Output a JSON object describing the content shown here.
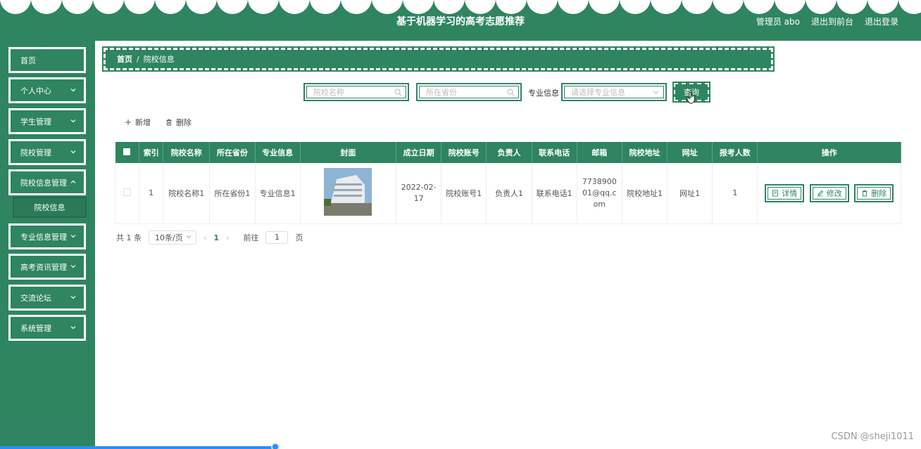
{
  "header": {
    "title": "基于机器学习的高考志愿推荐",
    "user_label": "管理员 abo",
    "back_label": "退出到前台",
    "logout_label": "退出登录",
    "bg_color": "#2e8560"
  },
  "sidebar": {
    "items": [
      {
        "label": "首页",
        "icon": "none"
      },
      {
        "label": "个人中心",
        "icon": "chevron-down-icon"
      },
      {
        "label": "学生管理",
        "icon": "chevron-down-icon"
      },
      {
        "label": "院校管理",
        "icon": "chevron-down-icon"
      },
      {
        "label": "院校信息管理",
        "icon": "chevron-down-icon"
      },
      {
        "label": "专业信息管理",
        "icon": "chevron-down-icon"
      },
      {
        "label": "高考资讯管理",
        "icon": "chevron-down-icon"
      },
      {
        "label": "交流论坛",
        "icon": "chevron-down-icon"
      },
      {
        "label": "系统管理",
        "icon": "chevron-down-icon"
      }
    ],
    "subitems": [
      {
        "label": "院校信息"
      }
    ]
  },
  "breadcrumb": {
    "home": "首页",
    "separator": "/",
    "current": "院校信息"
  },
  "search": {
    "school_placeholder": "院校名称",
    "province_placeholder": "所在省份",
    "major_label": "专业信息",
    "major_placeholder": "请选择专业信息",
    "query_label": "查询"
  },
  "actions": {
    "add_label": "新增",
    "delete_label": "删除"
  },
  "table": {
    "columns": [
      "索引",
      "院校名称",
      "所在省份",
      "专业信息",
      "封面",
      "成立日期",
      "院校账号",
      "负责人",
      "联系电话",
      "邮箱",
      "院校地址",
      "网址",
      "报考人数",
      "操作"
    ],
    "rows": [
      {
        "index": "1",
        "name": "院校名称1",
        "province": "所在省份1",
        "major": "专业信息1",
        "date": "2022-02-17",
        "account": "院校账号1",
        "leader": "负责人1",
        "phone": "联系电话1",
        "email": "773890001@qq.com",
        "address": "院校地址1",
        "website": "网址1",
        "applicants": "1"
      }
    ],
    "op_detail": "详情",
    "op_edit": "修改",
    "op_delete": "删除"
  },
  "pager": {
    "total": "共 1 条",
    "page_size": "10条/页",
    "current_page": "1",
    "goto_label": "前往",
    "goto_value": "1",
    "page_suffix": "页"
  },
  "watermark": "CSDN @sheji1011"
}
